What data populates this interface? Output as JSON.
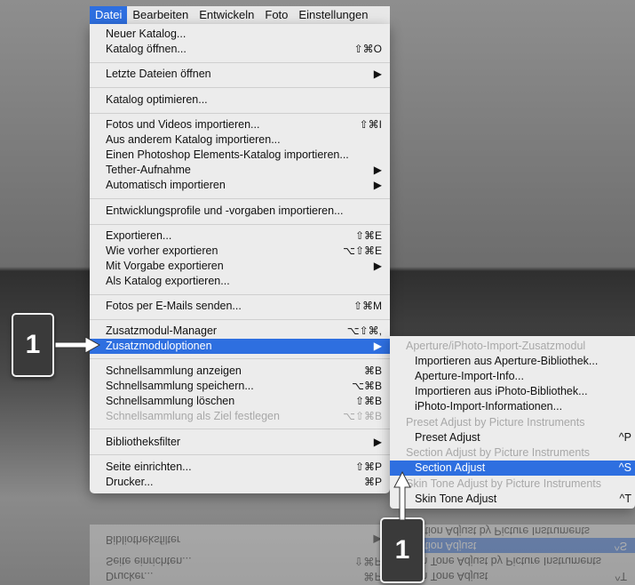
{
  "menubar": {
    "items": [
      "Datei",
      "Bearbeiten",
      "Entwickeln",
      "Foto",
      "Einstellungen"
    ]
  },
  "main_menu": {
    "items": [
      {
        "label": "Neuer Katalog...",
        "shortcut": ""
      },
      {
        "label": "Katalog öffnen...",
        "shortcut": "⇧⌘O"
      },
      {
        "label": "Letzte Dateien öffnen",
        "shortcut": "▶"
      },
      {
        "label": "Katalog optimieren...",
        "shortcut": ""
      },
      {
        "label": "Fotos und Videos importieren...",
        "shortcut": "⇧⌘I"
      },
      {
        "label": "Aus anderem Katalog importieren...",
        "shortcut": ""
      },
      {
        "label": "Einen Photoshop Elements-Katalog importieren...",
        "shortcut": ""
      },
      {
        "label": "Tether-Aufnahme",
        "shortcut": "▶"
      },
      {
        "label": "Automatisch importieren",
        "shortcut": "▶"
      },
      {
        "label": "Entwicklungsprofile und -vorgaben importieren...",
        "shortcut": ""
      },
      {
        "label": "Exportieren...",
        "shortcut": "⇧⌘E"
      },
      {
        "label": "Wie vorher exportieren",
        "shortcut": "⌥⇧⌘E"
      },
      {
        "label": "Mit Vorgabe exportieren",
        "shortcut": "▶"
      },
      {
        "label": "Als Katalog exportieren...",
        "shortcut": ""
      },
      {
        "label": "Fotos per E-Mails senden...",
        "shortcut": "⇧⌘M"
      },
      {
        "label": "Zusatzmodul-Manager",
        "shortcut": "⌥⇧⌘,"
      },
      {
        "label": "Zusatzmoduloptionen",
        "shortcut": "▶"
      },
      {
        "label": "Schnellsammlung anzeigen",
        "shortcut": "⌘B"
      },
      {
        "label": "Schnellsammlung speichern...",
        "shortcut": "⌥⌘B"
      },
      {
        "label": "Schnellsammlung löschen",
        "shortcut": "⇧⌘B"
      },
      {
        "label": "Schnellsammlung als Ziel festlegen",
        "shortcut": "⌥⇧⌘B"
      },
      {
        "label": "Bibliotheksfilter",
        "shortcut": "▶"
      },
      {
        "label": "Seite einrichten...",
        "shortcut": "⇧⌘P"
      },
      {
        "label": "Drucker...",
        "shortcut": "⌘P"
      }
    ]
  },
  "sub_menu": {
    "items": [
      {
        "label": "Aperture/iPhoto-Import-Zusatzmodul",
        "shortcut": ""
      },
      {
        "label": "Importieren aus Aperture-Bibliothek...",
        "shortcut": ""
      },
      {
        "label": "Aperture-Import-Info...",
        "shortcut": ""
      },
      {
        "label": "Importieren aus iPhoto-Bibliothek...",
        "shortcut": ""
      },
      {
        "label": "iPhoto-Import-Informationen...",
        "shortcut": ""
      },
      {
        "label": "Preset Adjust by Picture Instruments",
        "shortcut": ""
      },
      {
        "label": "Preset Adjust",
        "shortcut": "^P"
      },
      {
        "label": "Section Adjust by Picture Instruments",
        "shortcut": ""
      },
      {
        "label": "Section Adjust",
        "shortcut": "^S"
      },
      {
        "label": "Skin Tone Adjust by Picture Instruments",
        "shortcut": ""
      },
      {
        "label": "Skin Tone Adjust",
        "shortcut": "^T"
      }
    ]
  },
  "callouts": {
    "left": "1",
    "bottom": "1"
  },
  "colors": {
    "highlight": "#2e6fe0",
    "menu_bg": "#ececec",
    "callout_bg": "#3a3a3a"
  }
}
